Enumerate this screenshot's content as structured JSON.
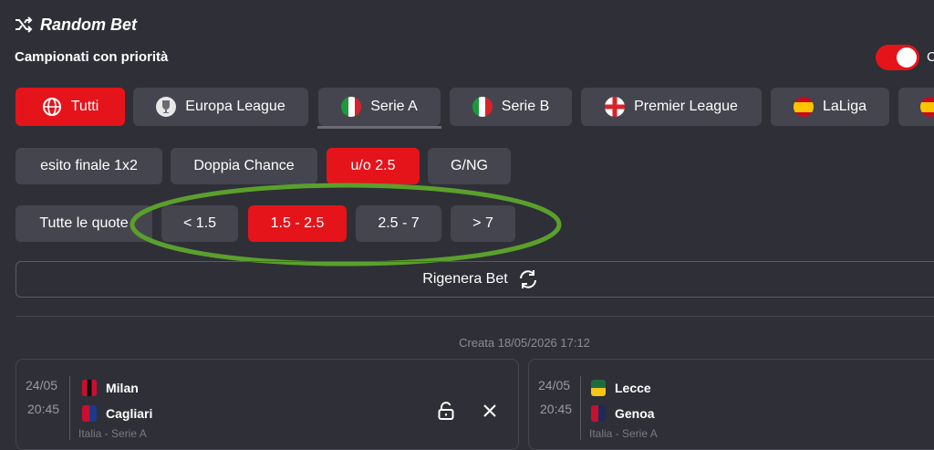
{
  "header": {
    "title": "Random Bet"
  },
  "priority": {
    "label": "Campionati con priorità",
    "edge_text": "C"
  },
  "leagues": [
    {
      "label": "Tutti",
      "icon": "globe-icon",
      "active": true
    },
    {
      "label": "Europa League",
      "icon": "trophy-icon"
    },
    {
      "label": "Serie A",
      "icon": "italy-flag-icon"
    },
    {
      "label": "Serie B",
      "icon": "italy-flag-icon"
    },
    {
      "label": "Premier League",
      "icon": "england-flag-icon"
    },
    {
      "label": "LaLiga",
      "icon": "spain-flag-icon"
    }
  ],
  "markets": [
    {
      "label": "esito finale 1x2"
    },
    {
      "label": "Doppia Chance"
    },
    {
      "label": "u/o 2.5",
      "active": true
    },
    {
      "label": "G/NG"
    }
  ],
  "odds": [
    {
      "label": "Tutte le quote"
    },
    {
      "label": "< 1.5"
    },
    {
      "label": "1.5 - 2.5",
      "active": true
    },
    {
      "label": "2.5 - 7"
    },
    {
      "label": "> 7"
    }
  ],
  "regenerate": {
    "label": "Rigenera Bet"
  },
  "created": "Creata 18/05/2026 17:12",
  "matches": [
    {
      "date": "24/05",
      "time": "20:45",
      "home": "Milan",
      "away": "Cagliari",
      "league": "Italia - Serie A"
    },
    {
      "date": "24/05",
      "time": "20:45",
      "home": "Lecce",
      "away": "Genoa",
      "league": "Italia - Serie A"
    }
  ],
  "colors": {
    "accent": "#e5141b",
    "background": "#2f2f37",
    "chip": "#45454f",
    "highlight_ellipse": "#5aa02c"
  }
}
